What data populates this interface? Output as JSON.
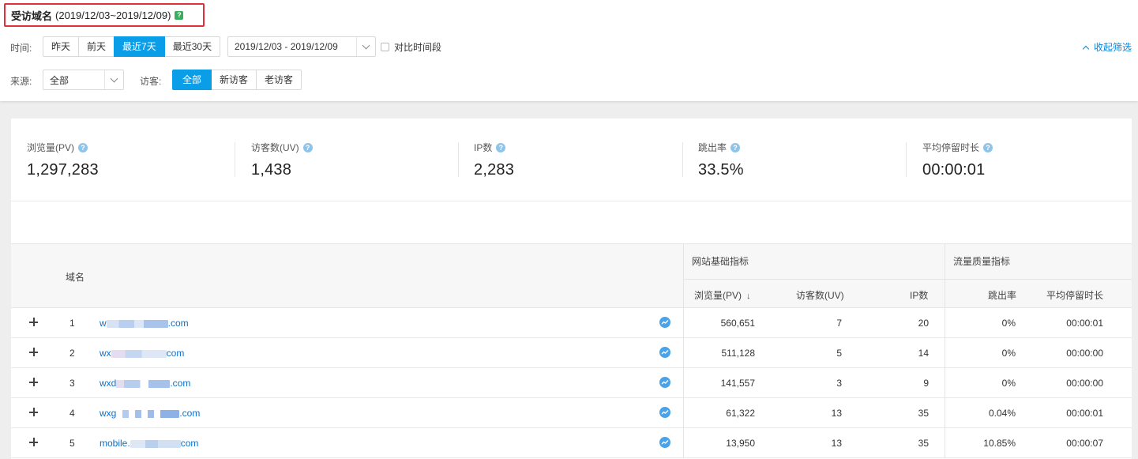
{
  "header": {
    "title": "受访域名",
    "date_range": "(2019/12/03~2019/12/09)",
    "help_glyph": "?"
  },
  "filters": {
    "time_label": "时间:",
    "time_options": [
      "昨天",
      "前天",
      "最近7天",
      "最近30天"
    ],
    "time_active": "最近7天",
    "date_picker_value": "2019/12/03 - 2019/12/09",
    "compare_label": "对比时间段",
    "collapse_label": "收起筛选",
    "source_label": "来源:",
    "source_value": "全部",
    "visitor_label": "访客:",
    "visitor_options": [
      "全部",
      "新访客",
      "老访客"
    ],
    "visitor_active": "全部"
  },
  "kpis": [
    {
      "label": "浏览量(PV)",
      "value": "1,297,283"
    },
    {
      "label": "访客数(UV)",
      "value": "1,438"
    },
    {
      "label": "IP数",
      "value": "2,283"
    },
    {
      "label": "跳出率",
      "value": "33.5%"
    },
    {
      "label": "平均停留时长",
      "value": "00:00:01"
    }
  ],
  "table": {
    "domain_header": "域名",
    "group_basic": "网站基础指标",
    "group_quality": "流量质量指标",
    "columns": {
      "pv": "浏览量(PV)",
      "pv_sort": "↓",
      "uv": "访客数(UV)",
      "ip": "IP数",
      "bounce": "跳出率",
      "avg_time": "平均停留时长"
    },
    "rows": [
      {
        "index": "1",
        "domain_prefix": "w",
        "domain_suffix": ".com",
        "pv": "560,651",
        "uv": "7",
        "ip": "20",
        "bounce": "0%",
        "avg_time": "00:00:01"
      },
      {
        "index": "2",
        "domain_prefix": "wx",
        "domain_suffix": "com",
        "pv": "511,128",
        "uv": "5",
        "ip": "14",
        "bounce": "0%",
        "avg_time": "00:00:00"
      },
      {
        "index": "3",
        "domain_prefix": "wxd",
        "domain_suffix": ".com",
        "pv": "141,557",
        "uv": "3",
        "ip": "9",
        "bounce": "0%",
        "avg_time": "00:00:00"
      },
      {
        "index": "4",
        "domain_prefix": "wxg",
        "domain_suffix": ".com",
        "pv": "61,322",
        "uv": "13",
        "ip": "35",
        "bounce": "0.04%",
        "avg_time": "00:00:01"
      },
      {
        "index": "5",
        "domain_prefix": "mobile.",
        "domain_suffix": "com",
        "pv": "13,950",
        "uv": "13",
        "ip": "35",
        "bounce": "10.85%",
        "avg_time": "00:00:07"
      }
    ]
  },
  "colors": {
    "accent": "#0a9ee8",
    "link": "#0a6fcf",
    "highlight_border": "#e0303a",
    "help_green": "#3aae5c"
  }
}
